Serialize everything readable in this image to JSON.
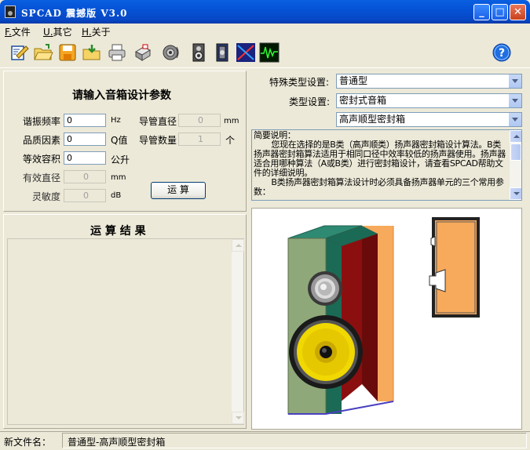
{
  "window": {
    "title": "SPCAD 震撼版 V3.0",
    "minimize": "_",
    "maximize": "□",
    "close": "✕"
  },
  "menu": [
    {
      "key": "F.",
      "label": "文件"
    },
    {
      "key": "U.",
      "label": "其它"
    },
    {
      "key": "H.",
      "label": "关于"
    }
  ],
  "toolbar_icons": [
    "edit-icon",
    "open-folder-icon",
    "save-icon",
    "export-icon",
    "print-icon",
    "printer-icon",
    "speaker-icon",
    "speaker-box-icon",
    "speaker-box2-icon",
    "crossover-icon",
    "waveform-icon",
    "help-icon"
  ],
  "params": {
    "heading": "请输入音箱设计参数",
    "fs": {
      "label": "谐振频率",
      "value": "0",
      "unit": "Hz"
    },
    "qts": {
      "label": "品质因素",
      "value": "0",
      "unit": "Q值"
    },
    "vas": {
      "label": "等效容积",
      "value": "0",
      "unit": "公升"
    },
    "sd": {
      "label": "有效直径",
      "value": "0",
      "unit": "mm"
    },
    "spl": {
      "label": "灵敏度",
      "value": "0",
      "unit": "dB"
    },
    "port_d": {
      "label": "导管直径",
      "value": "0",
      "unit": "mm"
    },
    "port_n": {
      "label": "导管数量",
      "value": "1",
      "unit": "个"
    },
    "calc_button": "运 算"
  },
  "results": {
    "heading": "运 算 结 果",
    "text": ""
  },
  "settings": {
    "special_type_label": "特殊类型设置:",
    "special_type_value": "普通型",
    "type_label": "类型设置:",
    "type_value": "密封式音箱",
    "sub_type_value": "高声顺型密封箱"
  },
  "description": {
    "text": "简要说明：\n       您现在选择的是B类（高声顺类）扬声器密封箱设计算法。B类扬声器密封箱算法适用于相同口径中效率较低的扬声器使用。扬声器适合用哪种算法（A或B类）进行密封箱设计，请查看SPCAD帮助文件的详细说明。\n       B类扬声器密封箱算法设计时必须具备扬声器单元的三个常用参数："
  },
  "status": {
    "label": "新文件名：",
    "value": "普通型-高声顺型密封箱"
  },
  "colors": {
    "titlebar": "#0553d6",
    "cabinet_front": "#8fa87a",
    "cabinet_top": "#2e8a72",
    "cabinet_inner": "#8b0f0f",
    "cabinet_side": "#f7a95c",
    "woofer_cone": "#f0d800"
  }
}
